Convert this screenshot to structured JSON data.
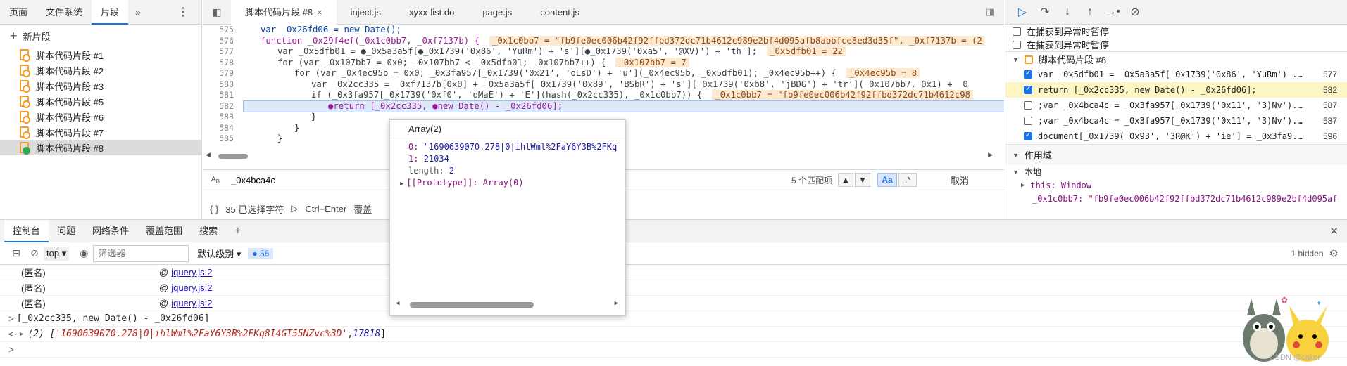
{
  "left_panel": {
    "tabs": [
      "页面",
      "文件系统",
      "片段"
    ],
    "more": "»",
    "menu": "⋮",
    "new_snippet": "新片段",
    "snippets": [
      "脚本代码片段 #1",
      "脚本代码片段 #2",
      "脚本代码片段 #3",
      "脚本代码片段 #5",
      "脚本代码片段 #6",
      "脚本代码片段 #7",
      "脚本代码片段 #8"
    ]
  },
  "editor": {
    "tabs": [
      "脚本代码片段 #8",
      "inject.js",
      "xyxx-list.do",
      "page.js",
      "content.js"
    ],
    "active_tab_close": "×",
    "line_numbers": [
      "575",
      "576",
      "577",
      "578",
      "579",
      "580",
      "581",
      "582",
      "583",
      "584",
      "585"
    ],
    "lines": [
      "var _0x26fd06 = new Date();",
      "function _0x29f4ef(_0x1c0bb7, _0xf7137b) {",
      "var _0x5dfb01 = ●_0x5a3a5f[●_0x1739('0x86', 'YuRm') + 's'][●_0x1739('0xa5', '@XV)') + 'th'];",
      "for (var _0x107bb7 = 0x0; _0x107bb7 < _0x5dfb01; _0x107bb7++) {",
      "for (var _0x4ec95b = 0x0; _0x3fa957[_0x1739('0x21', 'oLsD') + 'u'](_0x4ec95b, _0x5dfb01); _0x4ec95b++) {",
      "var _0x2cc335 = _0xf7137b[0x0] + _0x5a3a5f[_0x1739('0x89', 'BSbR') + 's'][_0x1739('0xb8', 'jBDG') + 'tr'](_0x107bb7, 0x1) + _0",
      "if (_0x3fa957[_0x1739('0xf0', 'oMaE') + 'E'](hash(_0x2cc335), _0x1c0bb7)) {",
      "●return [_0x2cc335, ●new Date() - _0x26fd06];",
      "}",
      "}",
      "}"
    ],
    "inline_values": {
      "l576": "_0x1c0bb7 = \"fb9fe0ec006b42f92ffbd372dc71b4612c989e2bf4d095afb8abbfce8ed3d35f\", _0xf7137b = (2",
      "l577": "_0x5dfb01 = 22",
      "l578": "_0x107bb7 = 7",
      "l579": "_0x4ec95b = 8",
      "l581": "_0x1c0bb7 = \"fb9fe0ec006b42f92ffbd372dc71b4612c98"
    },
    "search": {
      "value": "_0x4bca4c",
      "match_count": "5 个匹配项",
      "case_label": "Aa",
      "regex_label": ".*",
      "cancel": "取消"
    },
    "status": {
      "selected": "35 已选择字符",
      "run": "Ctrl+Enter",
      "cover": "覆盖"
    }
  },
  "debugger": {
    "pause_options": [
      "在捕获到异常时暂停",
      "在捕获到异常时暂停"
    ],
    "snippet_header": "脚本代码片段 #8",
    "breakpoints": [
      {
        "text": "var _0x5dfb01 = _0x5a3a5f[_0x1739('0x86', 'YuRm') ...",
        "line": "577",
        "checked": true
      },
      {
        "text": "return [_0x2cc335, new Date() - _0x26fd06];",
        "line": "582",
        "checked": true
      },
      {
        "text": ";var _0x4bca4c = _0x3fa957[_0x1739('0x11', '3)Nv')...",
        "line": "587",
        "checked": false
      },
      {
        "text": ";var _0x4bca4c = _0x3fa957[_0x1739('0x11', '3)Nv')...",
        "line": "587",
        "checked": false
      },
      {
        "text": "document[_0x1739('0x93', '3R@K') + 'ie'] = _0x3fa9...",
        "line": "596",
        "checked": true
      }
    ],
    "scope_header": "作用域",
    "local_header": "本地",
    "scope_this": "this: Window",
    "scope_var": "_0x1c0bb7: \"fb9fe0ec006b42f92ffbd372dc71b4612c989e2bf4d095af"
  },
  "popover": {
    "title": "Array(2)",
    "item0_key": "0:",
    "item0_val": "\"1690639070.278|0|ihlWml%2FaY6Y3B%2FKq",
    "item1_key": "1:",
    "item1_val": "21034",
    "length_key": "length:",
    "length_val": "2",
    "proto": "[[Prototype]]: Array(0)"
  },
  "drawer": {
    "tabs": [
      "控制台",
      "问题",
      "网络条件",
      "覆盖范围",
      "搜索"
    ],
    "add": "+",
    "close": "✕",
    "context": "top",
    "filter_placeholder": "筛选器",
    "level": "默认级别",
    "message_count": "56",
    "hidden": "1 hidden",
    "log_rows": [
      {
        "name": "(匿名)",
        "at": "@",
        "link": "jquery.js:2"
      },
      {
        "name": "(匿名)",
        "at": "@",
        "link": "jquery.js:2"
      },
      {
        "name": "(匿名)",
        "at": "@",
        "link": "jquery.js:2"
      }
    ],
    "command": "[_0x2cc335, new Date() - _0x26fd06]",
    "result_prefix": "(2) [",
    "result_str": "'1690639070.278|0|ihlWml%2FaY6Y3B%2FKq8I4GT55NZvc%3D'",
    "result_sep": ", ",
    "result_num": "17818",
    "result_suffix": "]",
    "watermark": "CSDN @caker"
  },
  "colors": {
    "accent": "#1a73e8",
    "breakpoint": "#e53935",
    "inline_value_bg": "#fde8d0",
    "current_line_bg": "#dde8f9"
  }
}
